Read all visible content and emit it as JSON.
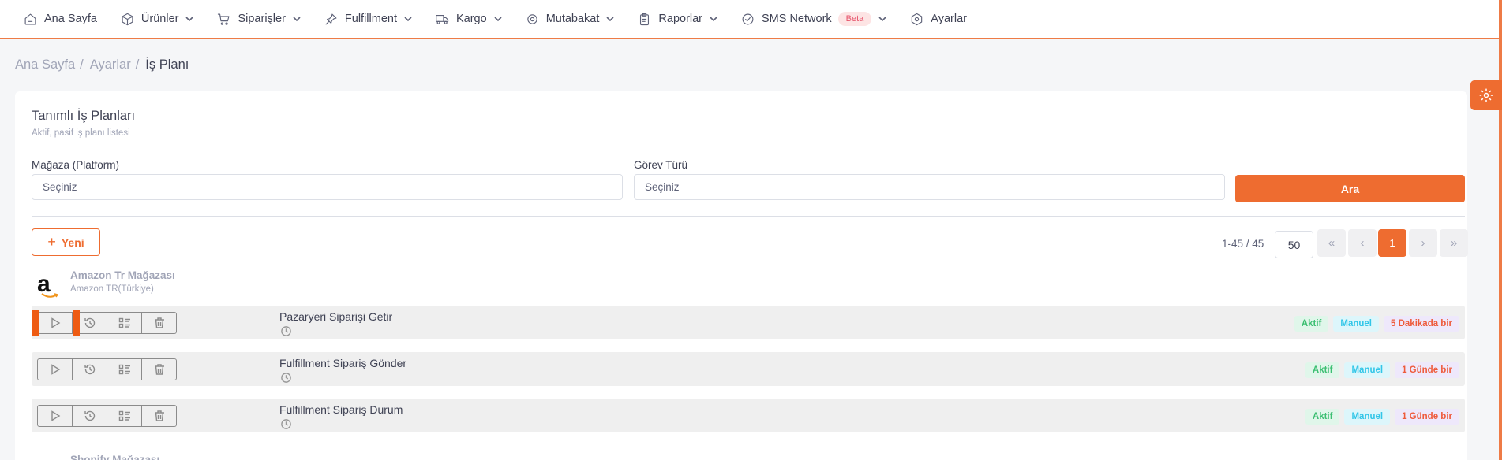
{
  "nav": {
    "items": [
      {
        "label": "Ana Sayfa",
        "icon": "home-icon",
        "dropdown": false
      },
      {
        "label": "Ürünler",
        "icon": "box-icon",
        "dropdown": true
      },
      {
        "label": "Siparişler",
        "icon": "cart-icon",
        "dropdown": true
      },
      {
        "label": "Fulfillment",
        "icon": "pin-icon",
        "dropdown": true
      },
      {
        "label": "Kargo",
        "icon": "truck-icon",
        "dropdown": true
      },
      {
        "label": "Mutabakat",
        "icon": "sync-icon",
        "dropdown": true
      },
      {
        "label": "Raporlar",
        "icon": "clipboard-icon",
        "dropdown": true
      },
      {
        "label": "SMS Network",
        "icon": "check-circle-icon",
        "dropdown": true,
        "badge": "Beta"
      },
      {
        "label": "Ayarlar",
        "icon": "gear-icon",
        "dropdown": false
      }
    ]
  },
  "breadcrumb": {
    "home": "Ana Sayfa",
    "settings": "Ayarlar",
    "current": "İş Planı"
  },
  "card": {
    "title": "Tanımlı İş Planları",
    "subtitle": "Aktif, pasif iş planı listesi",
    "filters": {
      "store_label": "Mağaza (Platform)",
      "store_value": "Seçiniz",
      "task_type_label": "Görev Türü",
      "task_type_value": "Seçiniz",
      "search_button": "Ara"
    },
    "new_button": "Yeni",
    "pagination": {
      "info": "1-45 / 45",
      "per_page": "50",
      "first": "«",
      "prev": "‹",
      "current": "1",
      "next": "›",
      "last": "»"
    }
  },
  "store": {
    "name": "Amazon Tr Mağazası",
    "platform": "Amazon TR(Türkiye)",
    "logo_letter": "a"
  },
  "tasks": [
    {
      "name": "Pazaryeri Siparişi Getir",
      "status": "Aktif",
      "mode": "Manuel",
      "frequency": "5 Dakikada bir"
    },
    {
      "name": "Fulfillment Sipariş Gönder",
      "status": "Aktif",
      "mode": "Manuel",
      "frequency": "1 Günde bir"
    },
    {
      "name": "Fulfillment Sipariş Durum",
      "status": "Aktif",
      "mode": "Manuel",
      "frequency": "1 Günde bir"
    }
  ],
  "next_store": {
    "name": "Shopify Mağazası"
  },
  "colors": {
    "accent": "#ee6c30",
    "active_green": "#3cbf72",
    "manual_cyan": "#32c6e8",
    "frequency_red": "#ee5b3c"
  }
}
